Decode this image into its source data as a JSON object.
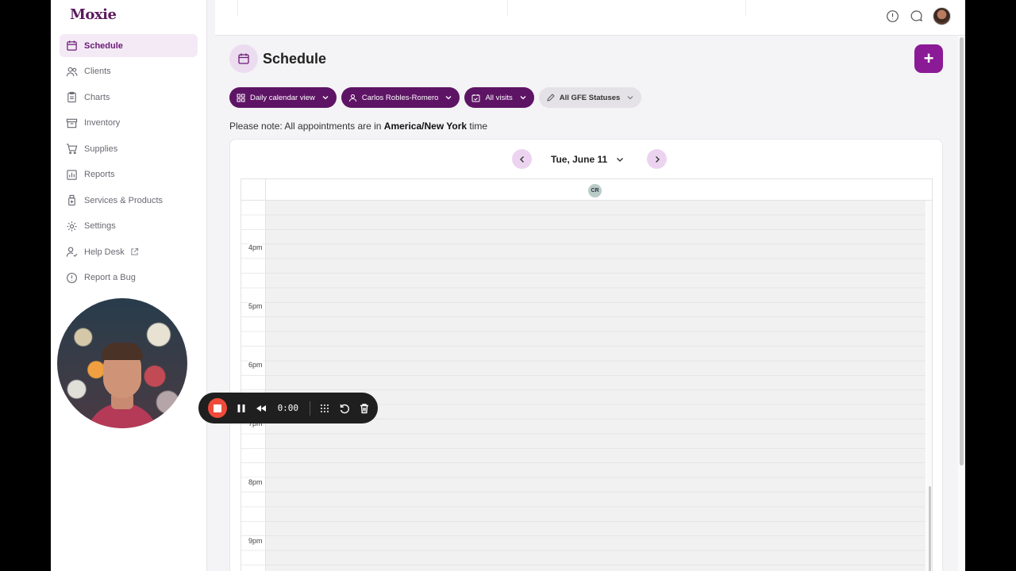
{
  "app": {
    "logo": "Moxie"
  },
  "sidebar": {
    "items": [
      {
        "label": "Schedule",
        "icon": "calendar-icon",
        "active": true
      },
      {
        "label": "Clients",
        "icon": "users-icon"
      },
      {
        "label": "Charts",
        "icon": "clipboard-icon"
      },
      {
        "label": "Inventory",
        "icon": "archive-icon"
      },
      {
        "label": "Supplies",
        "icon": "cart-icon"
      },
      {
        "label": "Reports",
        "icon": "bar-chart-icon"
      },
      {
        "label": "Services & Products",
        "icon": "bottle-icon"
      },
      {
        "label": "Settings",
        "icon": "gear-icon"
      },
      {
        "label": "Help Desk",
        "icon": "person-help-icon",
        "external": true
      },
      {
        "label": "Report a Bug",
        "icon": "alert-circle-icon"
      }
    ]
  },
  "recorder": {
    "time": "0:00"
  },
  "page": {
    "title": "Schedule",
    "add_label": "+"
  },
  "filters": {
    "view": "Daily calendar view",
    "provider": "Carlos Robles-Romero",
    "visits": "All visits",
    "gfe": "All GFE Statuses"
  },
  "note": {
    "prefix": "Please note: All appointments are in ",
    "timezone": "America/New York",
    "suffix": " time"
  },
  "calendar": {
    "date": "Tue, June 11",
    "provider_initials": "CR",
    "hours": [
      "4pm",
      "5pm",
      "6pm",
      "7pm",
      "8pm",
      "9pm"
    ]
  },
  "colors": {
    "brand": "#5e1465",
    "accent": "#8a1a96",
    "record": "#ef4a3a"
  }
}
